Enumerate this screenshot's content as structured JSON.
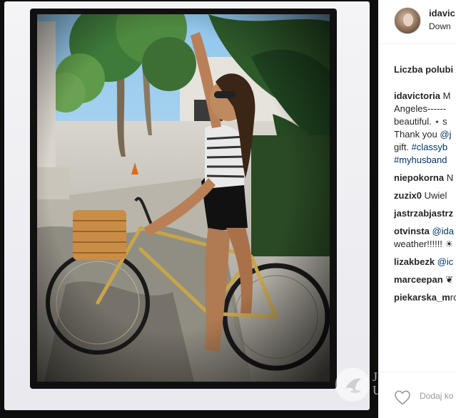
{
  "post": {
    "username": "idavic",
    "location": "Down",
    "likes_label": "Liczba polubi",
    "comments": [
      {
        "user": "idavictoria",
        "lines": [
          [
            {
              "t": "text",
              "v": " M"
            }
          ],
          [
            {
              "t": "text",
              "v": "Angeles------"
            }
          ],
          [
            {
              "t": "text",
              "v": "beautiful. ⋆ s"
            }
          ],
          [
            {
              "t": "text",
              "v": "Thank you "
            },
            {
              "t": "link",
              "v": "@j"
            }
          ],
          [
            {
              "t": "text",
              "v": "gift. "
            },
            {
              "t": "link",
              "v": "#classyb"
            }
          ],
          [
            {
              "t": "link",
              "v": "#myhusband"
            }
          ]
        ]
      },
      {
        "user": "niepokorna",
        "lines": [
          [
            {
              "t": "text",
              "v": " N"
            }
          ]
        ]
      },
      {
        "user": "zuzix0",
        "lines": [
          [
            {
              "t": "text",
              "v": " Uwiel"
            }
          ]
        ]
      },
      {
        "user": "jastrzabjastrz",
        "lines": []
      },
      {
        "user": "otvinsta",
        "lines": [
          [
            {
              "t": "text",
              "v": " "
            },
            {
              "t": "link",
              "v": "@ida"
            }
          ],
          [
            {
              "t": "text",
              "v": "weather!!!!!! ☀"
            }
          ]
        ]
      },
      {
        "user": "lizakbezk",
        "lines": [
          [
            {
              "t": "text",
              "v": " "
            },
            {
              "t": "link",
              "v": "@ic"
            }
          ]
        ]
      },
      {
        "user": "marceepan",
        "lines": [
          [
            {
              "t": "text",
              "v": " ❦"
            }
          ]
        ]
      },
      {
        "user": "piekarska_m",
        "lines": [
          [
            {
              "t": "text",
              "v": "rower kochar"
            }
          ]
        ]
      }
    ],
    "add_comment_placeholder": "Dodaj ko"
  },
  "watermark_text": "J\nU"
}
